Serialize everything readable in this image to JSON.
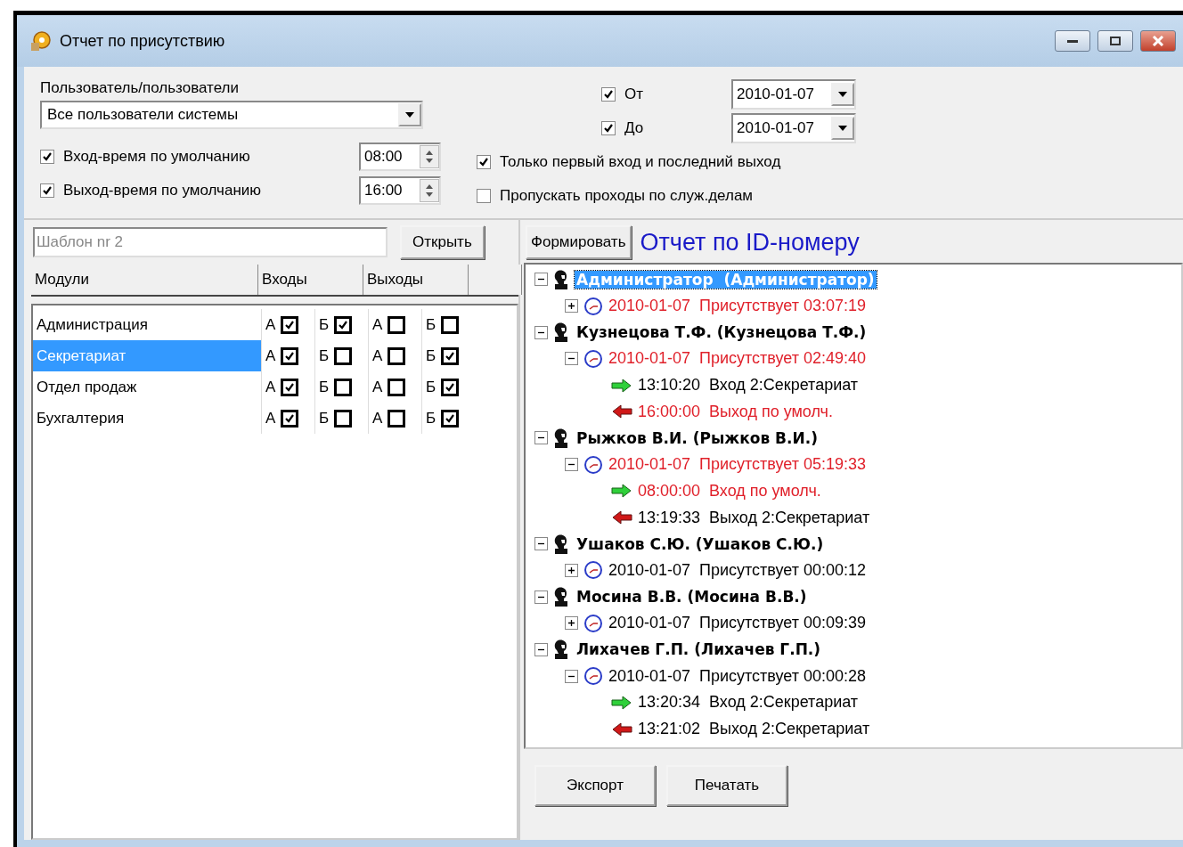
{
  "window": {
    "title": "Отчет по присутствию"
  },
  "filters": {
    "users_label": "Пользователь/пользователи",
    "users_value": "Все пользователи системы",
    "dates": [
      {
        "label": "От",
        "checked": true,
        "value": "2010-01-07"
      },
      {
        "label": "До",
        "checked": true,
        "value": "2010-01-07"
      }
    ],
    "default_times": [
      {
        "label": "Вход-время по умолчанию",
        "checked": true,
        "value": "08:00"
      },
      {
        "label": "Выход-время по умолчанию",
        "checked": true,
        "value": "16:00"
      }
    ],
    "options": [
      {
        "label": "Только первый вход и последний выход",
        "checked": true
      },
      {
        "label": "Пропускать проходы по служ.делам",
        "checked": false
      }
    ]
  },
  "template": {
    "placeholder": "Шаблон nr 2",
    "open_button": "Открыть"
  },
  "report": {
    "form_button": "Формировать",
    "title": "Отчет по ID-номеру"
  },
  "modules": {
    "columns": [
      "Модули",
      "Входы",
      "Выходы"
    ],
    "rows": [
      {
        "name": "Администрация",
        "selected": false,
        "checks": [
          {
            "label": "А",
            "checked": true
          },
          {
            "label": "Б",
            "checked": true
          },
          {
            "label": "А",
            "checked": false
          },
          {
            "label": "Б",
            "checked": false
          }
        ]
      },
      {
        "name": "Секретариат",
        "selected": true,
        "checks": [
          {
            "label": "А",
            "checked": true
          },
          {
            "label": "Б",
            "checked": false
          },
          {
            "label": "А",
            "checked": false
          },
          {
            "label": "Б",
            "checked": true
          }
        ]
      },
      {
        "name": "Отдел продаж",
        "selected": false,
        "checks": [
          {
            "label": "А",
            "checked": true
          },
          {
            "label": "Б",
            "checked": false
          },
          {
            "label": "А",
            "checked": false
          },
          {
            "label": "Б",
            "checked": true
          }
        ]
      },
      {
        "name": "Бухгалтерия",
        "selected": false,
        "checks": [
          {
            "label": "А",
            "checked": true
          },
          {
            "label": "Б",
            "checked": false
          },
          {
            "label": "А",
            "checked": false
          },
          {
            "label": "Б",
            "checked": true
          }
        ]
      }
    ]
  },
  "tree": [
    {
      "text": "Администратор  (Администратор)",
      "expanded": true,
      "selected": true,
      "children": [
        {
          "text": "2010-01-07  Присутствует 03:07:19",
          "expanded": false,
          "alert": true
        }
      ]
    },
    {
      "text": "Кузнецова Т.Ф. (Кузнецова Т.Ф.)",
      "expanded": true,
      "selected": false,
      "children": [
        {
          "text": "2010-01-07  Присутствует 02:49:40",
          "expanded": true,
          "alert": true,
          "children": [
            {
              "kind": "entry",
              "text": "13:10:20  Вход 2:Секретариат",
              "alert": false
            },
            {
              "kind": "exit",
              "text": "16:00:00  Выход по умолч.",
              "alert": true
            }
          ]
        }
      ]
    },
    {
      "text": "Рыжков В.И. (Рыжков В.И.)",
      "expanded": true,
      "selected": false,
      "children": [
        {
          "text": "2010-01-07  Присутствует 05:19:33",
          "expanded": true,
          "alert": true,
          "children": [
            {
              "kind": "entry",
              "text": "08:00:00  Вход по умолч.",
              "alert": true
            },
            {
              "kind": "exit",
              "text": "13:19:33  Выход 2:Секретариат",
              "alert": false
            }
          ]
        }
      ]
    },
    {
      "text": "Ушаков С.Ю. (Ушаков С.Ю.)",
      "expanded": true,
      "selected": false,
      "children": [
        {
          "text": "2010-01-07  Присутствует 00:00:12",
          "expanded": false,
          "alert": false
        }
      ]
    },
    {
      "text": "Мосина В.В. (Мосина В.В.)",
      "expanded": true,
      "selected": false,
      "children": [
        {
          "text": "2010-01-07  Присутствует 00:09:39",
          "expanded": false,
          "alert": false
        }
      ]
    },
    {
      "text": "Лихачев Г.П. (Лихачев Г.П.)",
      "expanded": true,
      "selected": false,
      "children": [
        {
          "text": "2010-01-07  Присутствует 00:00:28",
          "expanded": true,
          "alert": false,
          "children": [
            {
              "kind": "entry",
              "text": "13:20:34  Вход 2:Секретариат",
              "alert": false
            },
            {
              "kind": "exit",
              "text": "13:21:02  Выход 2:Секретариат",
              "alert": false
            }
          ]
        }
      ]
    }
  ],
  "buttons": [
    "Экспорт",
    "Печатать"
  ]
}
